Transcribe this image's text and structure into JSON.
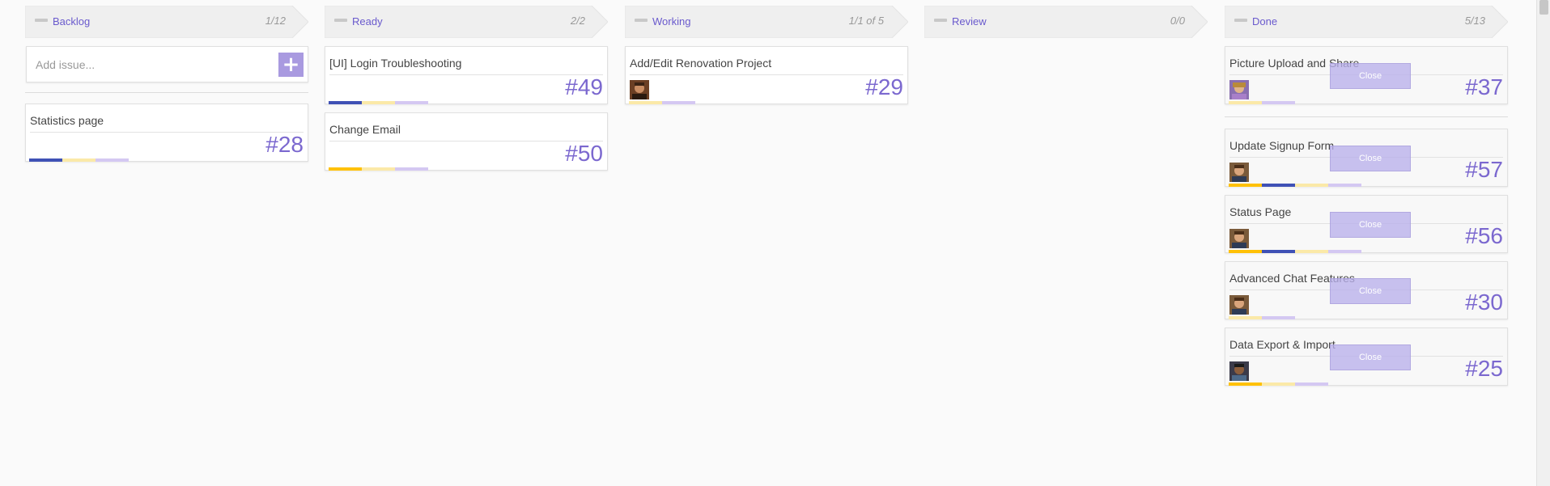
{
  "columns": [
    {
      "title": "Backlog",
      "count": "1/12"
    },
    {
      "title": "Ready",
      "count": "2/2"
    },
    {
      "title": "Working",
      "count": "1/1 of 5"
    },
    {
      "title": "Review",
      "count": "0/0"
    },
    {
      "title": "Done",
      "count": "5/13"
    }
  ],
  "backlog": {
    "add_placeholder": "Add issue...",
    "add_symbol": "+",
    "cards": [
      {
        "title": "Statistics page",
        "number": "#28",
        "bars": [
          "blue",
          "yellow",
          "lavender"
        ]
      }
    ]
  },
  "ready": {
    "cards": [
      {
        "title": "[UI] Login Troubleshooting",
        "number": "#49",
        "bars": [
          "blue",
          "yellow",
          "lavender"
        ]
      },
      {
        "title": "Change Email",
        "number": "#50",
        "bars": [
          "orange",
          "yellow",
          "lavender"
        ]
      }
    ]
  },
  "working": {
    "cards": [
      {
        "title": "Add/Edit Renovation Project",
        "number": "#29",
        "bars": [
          "yellow",
          "lavender"
        ]
      }
    ]
  },
  "done": {
    "close_label": "Close",
    "cards": [
      {
        "title": "Picture Upload and Share",
        "number": "#37",
        "bars": [
          "yellow",
          "lavender"
        ]
      },
      {
        "title": "Update Signup Form",
        "number": "#57",
        "bars": [
          "orange",
          "blue",
          "yellow",
          "lavender"
        ]
      },
      {
        "title": "Status Page",
        "number": "#56",
        "bars": [
          "orange",
          "blue",
          "yellow",
          "lavender"
        ]
      },
      {
        "title": "Advanced Chat Features",
        "number": "#30",
        "bars": [
          "yellow",
          "lavender"
        ]
      },
      {
        "title": "Data Export & Import",
        "number": "#25",
        "bars": [
          "orange",
          "yellow",
          "lavender"
        ]
      }
    ]
  },
  "colors": {
    "accent": "#6a5acd",
    "header_bg": "#efefef",
    "number": "#7b68cf",
    "bar_blue": "#3f51b5",
    "bar_yellow": "#fbe9a8",
    "bar_orange": "#ffc107",
    "bar_lavender": "#d4c8f2",
    "close_button": "#b9afeb"
  },
  "icons": {
    "collapse": "minus-icon",
    "add": "plus-icon",
    "avatar": "user-avatar-icon"
  }
}
